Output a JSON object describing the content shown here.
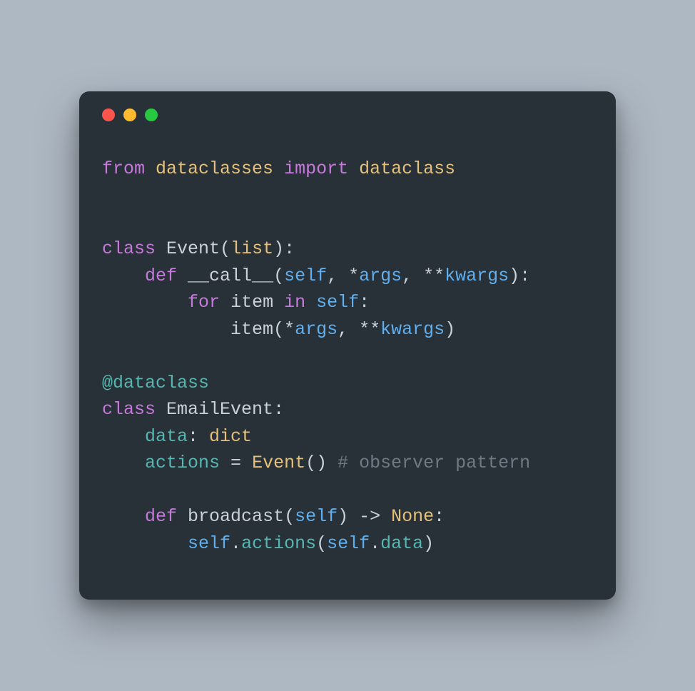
{
  "traffic_lights": [
    "red",
    "yellow",
    "green"
  ],
  "code": {
    "l1": {
      "kw_from": "from",
      "module": "dataclasses",
      "kw_import": "import",
      "name": "dataclass"
    },
    "l4": {
      "kw_class": "class",
      "cls": "Event",
      "base": "list"
    },
    "l5": {
      "kw_def": "def",
      "fn": "__call__",
      "self": "self",
      "args": "args",
      "kwargs": "kwargs"
    },
    "l6": {
      "kw_for": "for",
      "var": "item",
      "kw_in": "in",
      "self": "self"
    },
    "l7": {
      "fn": "item",
      "args": "args",
      "kwargs": "kwargs"
    },
    "l9": {
      "decorator": "@dataclass"
    },
    "l10": {
      "kw_class": "class",
      "cls": "EmailEvent"
    },
    "l11": {
      "name": "data",
      "type": "dict"
    },
    "l12": {
      "name": "actions",
      "ctor": "Event",
      "comment": "# observer pattern"
    },
    "l14": {
      "kw_def": "def",
      "fn": "broadcast",
      "self": "self",
      "ret": "None"
    },
    "l15": {
      "self1": "self",
      "attr1": "actions",
      "self2": "self",
      "attr2": "data"
    }
  }
}
